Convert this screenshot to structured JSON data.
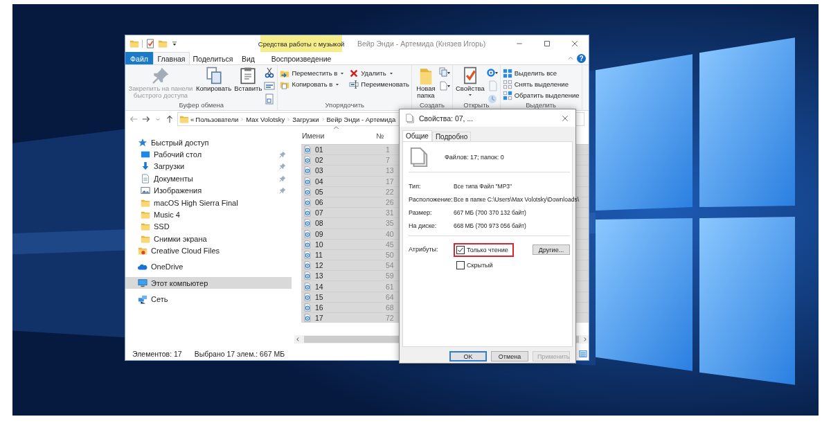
{
  "window": {
    "title": "Вейр Энди - Артемида (Князев Игорь)",
    "context_group": "Средства работы с музыкой",
    "help": "?"
  },
  "tabs": [
    {
      "label": "Файл",
      "kind": "file",
      "selected": false
    },
    {
      "label": "Главная",
      "kind": "tab",
      "selected": true
    },
    {
      "label": "Поделиться",
      "kind": "tab",
      "selected": false
    },
    {
      "label": "Вид",
      "kind": "tab",
      "selected": false
    },
    {
      "label": "Воспроизведение",
      "kind": "context",
      "selected": false
    }
  ],
  "ribbon": [
    {
      "label": "Буфер обмена",
      "commands": [
        {
          "kind": "large",
          "label": "Закрепить на панели быстрого доступа",
          "disabled": true,
          "dropdown": false
        },
        {
          "kind": "large",
          "label": "Копировать",
          "disabled": false,
          "dropdown": false
        },
        {
          "kind": "large",
          "label": "Вставить",
          "disabled": false,
          "dropdown": false
        }
      ]
    },
    {
      "label": "Упорядочить",
      "commands": [
        {
          "kind": "small",
          "label": "Переместить в",
          "disabled": false,
          "dropdown": true
        },
        {
          "kind": "small",
          "label": "Копировать в",
          "disabled": false,
          "dropdown": true
        },
        {
          "kind": "small",
          "label": "Удалить",
          "disabled": false,
          "dropdown": true
        },
        {
          "kind": "small",
          "label": "Переименовать",
          "disabled": false,
          "dropdown": false
        }
      ]
    },
    {
      "label": "Создать",
      "commands": [
        {
          "kind": "large",
          "label": "Новая папка",
          "disabled": false,
          "dropdown": false
        }
      ]
    },
    {
      "label": "Открыть",
      "commands": [
        {
          "kind": "large",
          "label": "Свойства",
          "disabled": false,
          "dropdown": true
        }
      ]
    },
    {
      "label": "Выделить",
      "commands": [
        {
          "kind": "small",
          "label": "Выделить все",
          "disabled": false,
          "dropdown": false
        },
        {
          "kind": "small",
          "label": "Снять выделение",
          "disabled": false,
          "dropdown": false
        },
        {
          "kind": "small",
          "label": "Обратить выделение",
          "disabled": false,
          "dropdown": false
        }
      ]
    }
  ],
  "address": {
    "overflow_mark": "«",
    "path": [
      "Пользователи",
      "Max Volotsky",
      "Загрузки",
      "Вейр Энди - Артемида"
    ]
  },
  "nav": [
    {
      "label": "Быстрый доступ",
      "selected": false,
      "children": [
        {
          "label": "Рабочий стол",
          "pinned": true,
          "selected": false
        },
        {
          "label": "Загрузки",
          "pinned": true,
          "selected": false
        },
        {
          "label": "Документы",
          "pinned": true,
          "selected": false
        },
        {
          "label": "Изображения",
          "pinned": true,
          "selected": false
        },
        {
          "label": "macOS High Sierra Final",
          "pinned": false,
          "selected": false
        },
        {
          "label": "Music 4",
          "pinned": false,
          "selected": false
        },
        {
          "label": "SSD",
          "pinned": false,
          "selected": false
        },
        {
          "label": "Снимки экрана",
          "pinned": false,
          "selected": false
        }
      ]
    },
    {
      "label": "Creative Cloud Files",
      "selected": false
    },
    {
      "label": "OneDrive",
      "selected": false
    },
    {
      "label": "Этот компьютер",
      "selected": true
    },
    {
      "label": "Сеть",
      "selected": false
    }
  ],
  "files": {
    "columns": [
      {
        "label": "Имени",
        "sorted": true
      },
      {
        "label": "№",
        "sorted": false
      }
    ],
    "rows": [
      {
        "name": "01",
        "number": "1",
        "selected": true
      },
      {
        "name": "02",
        "number": "7",
        "selected": true
      },
      {
        "name": "03",
        "number": "13",
        "selected": true
      },
      {
        "name": "04",
        "number": "17",
        "selected": true
      },
      {
        "name": "05",
        "number": "22",
        "selected": true
      },
      {
        "name": "06",
        "number": "26",
        "selected": true
      },
      {
        "name": "07",
        "number": "31",
        "selected": true
      },
      {
        "name": "08",
        "number": "35",
        "selected": true
      },
      {
        "name": "09",
        "number": "40",
        "selected": true
      },
      {
        "name": "10",
        "number": "45",
        "selected": true
      },
      {
        "name": "11",
        "number": "50",
        "selected": true
      },
      {
        "name": "12",
        "number": "54",
        "selected": true
      },
      {
        "name": "13",
        "number": "59",
        "selected": true
      },
      {
        "name": "14",
        "number": "61",
        "selected": true
      },
      {
        "name": "15",
        "number": "64",
        "selected": true
      },
      {
        "name": "16",
        "number": "68",
        "selected": true
      },
      {
        "name": "17",
        "number": "72",
        "selected": true
      }
    ]
  },
  "status": {
    "count": "Элементов: 17",
    "selection": "Выбрано 17 элем.: 667 МБ"
  },
  "dialog": {
    "title": "Свойства: 07, ...",
    "tabs": [
      {
        "label": "Общие",
        "selected": true
      },
      {
        "label": "Подробно",
        "selected": false
      }
    ],
    "summary": "Файлов: 17; папок: 0",
    "properties": [
      {
        "label": "Тип:",
        "value": "Все типа Файл \"MP3\""
      },
      {
        "label": "Расположение:",
        "value": "Все в папке C:\\Users\\Max Volotsky\\Downloads\\"
      },
      {
        "label": "Размер:",
        "value": "667 МБ (700 370 132 байт)"
      },
      {
        "label": "На диске:",
        "value": "668 МБ (700 973 056 байт)"
      }
    ],
    "attributes_label": "Атрибуты:",
    "attributes": [
      {
        "label": "Только чтение",
        "checked": true,
        "highlighted": true
      },
      {
        "label": "Скрытый",
        "checked": false,
        "highlighted": false
      }
    ],
    "other_button": "Другие...",
    "buttons": [
      {
        "label": "OK",
        "default": true,
        "disabled": false
      },
      {
        "label": "Отмена",
        "default": false,
        "disabled": false
      },
      {
        "label": "Применить",
        "default": false,
        "disabled": true
      }
    ]
  }
}
